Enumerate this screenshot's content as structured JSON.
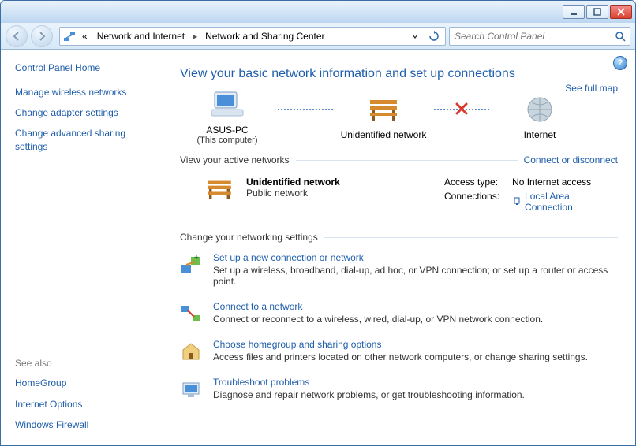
{
  "breadcrumb": {
    "ellipsis": "«",
    "parent": "Network and Internet",
    "current": "Network and Sharing Center"
  },
  "search": {
    "placeholder": "Search Control Panel"
  },
  "sidebar": {
    "home": "Control Panel Home",
    "links": [
      "Manage wireless networks",
      "Change adapter settings",
      "Change advanced sharing settings"
    ],
    "see_also_hdr": "See also",
    "see_also": [
      "HomeGroup",
      "Internet Options",
      "Windows Firewall"
    ]
  },
  "page": {
    "title": "View your basic network information and set up connections",
    "full_map": "See full map",
    "nodes": {
      "computer": "ASUS-PC",
      "computer_sub": "(This computer)",
      "network": "Unidentified network",
      "internet": "Internet"
    },
    "active_hdr": "View your active networks",
    "connect_link": "Connect or disconnect",
    "active": {
      "name": "Unidentified network",
      "type": "Public network",
      "access_label": "Access type:",
      "access_value": "No Internet access",
      "conn_label": "Connections:",
      "conn_value": "Local Area Connection"
    },
    "change_hdr": "Change your networking settings",
    "settings": [
      {
        "title": "Set up a new connection or network",
        "desc": "Set up a wireless, broadband, dial-up, ad hoc, or VPN connection; or set up a router or access point."
      },
      {
        "title": "Connect to a network",
        "desc": "Connect or reconnect to a wireless, wired, dial-up, or VPN network connection."
      },
      {
        "title": "Choose homegroup and sharing options",
        "desc": "Access files and printers located on other network computers, or change sharing settings."
      },
      {
        "title": "Troubleshoot problems",
        "desc": "Diagnose and repair network problems, or get troubleshooting information."
      }
    ]
  }
}
